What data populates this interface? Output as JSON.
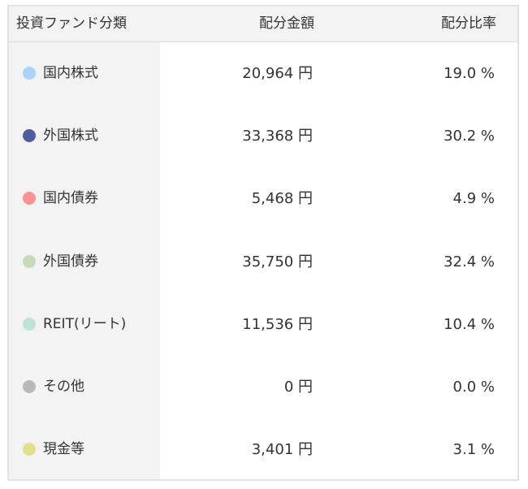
{
  "table": {
    "headers": {
      "category": "投資ファンド分類",
      "amount": "配分金額",
      "ratio": "配分比率"
    },
    "rows": [
      {
        "label": "国内株式",
        "amount": "20,964 円",
        "ratio": "19.0 %",
        "color": "#a9d4f7"
      },
      {
        "label": "外国株式",
        "amount": "33,368 円",
        "ratio": "30.2 %",
        "color": "#4f5e9e"
      },
      {
        "label": "国内債券",
        "amount": "5,468 円",
        "ratio": "4.9 %",
        "color": "#f79492"
      },
      {
        "label": "外国債券",
        "amount": "35,750 円",
        "ratio": "32.4 %",
        "color": "#c8dbb8"
      },
      {
        "label": "REIT(リート)",
        "amount": "11,536 円",
        "ratio": "10.4 %",
        "color": "#bfe3d8"
      },
      {
        "label": "その他",
        "amount": "0 円",
        "ratio": "0.0 %",
        "color": "#b9b9b9"
      },
      {
        "label": "現金等",
        "amount": "3,401 円",
        "ratio": "3.1 %",
        "color": "#e3df8c"
      }
    ]
  }
}
